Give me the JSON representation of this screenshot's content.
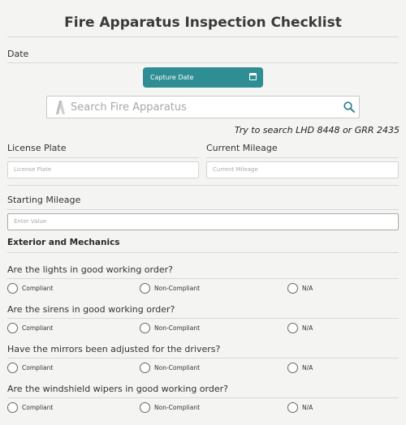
{
  "title": "Fire Apparatus Inspection Checklist",
  "date": {
    "label": "Date",
    "button_label": "Capture Date",
    "button_icon": "calendar-icon"
  },
  "search": {
    "placeholder": "Search Fire Apparatus",
    "hint": "Try to search LHD 8448 or GRR 2435"
  },
  "license_plate": {
    "label": "License Plate",
    "placeholder": "License Plate"
  },
  "current_mileage": {
    "label": "Current Mileage",
    "placeholder": "Current Mileage"
  },
  "starting_mileage": {
    "label": "Starting Mileage",
    "placeholder": "Enter Value"
  },
  "section_title": "Exterior and Mechanics",
  "options": [
    "Compliant",
    "Non-Compliant",
    "N/A"
  ],
  "questions": [
    "Are the lights in good working order?",
    "Are the sirens in good working order?",
    "Have the mirrors been adjusted for the drivers?",
    "Are the windshield wipers in good working order?"
  ],
  "colors": {
    "accent": "#2f8e94",
    "background": "#f4f4f2"
  }
}
